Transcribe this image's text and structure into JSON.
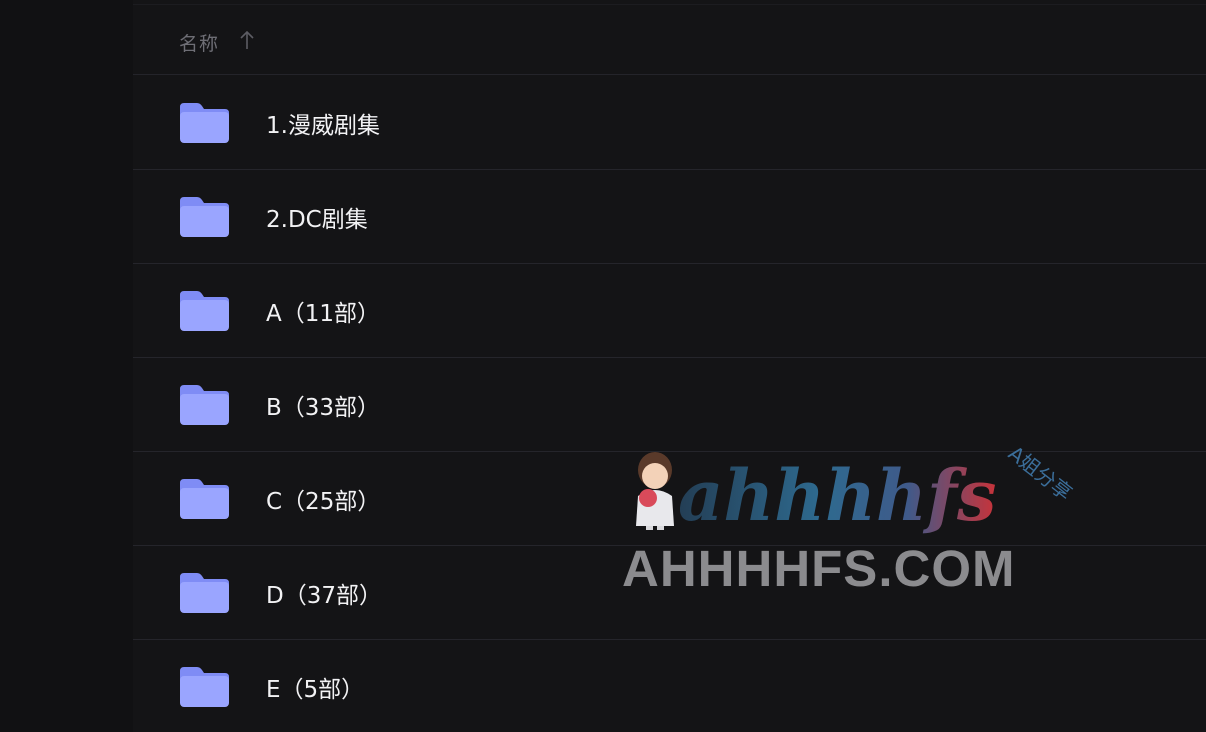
{
  "file_list": {
    "header": {
      "name_column_label": "名称",
      "sort_direction": "ascending"
    },
    "folders": [
      {
        "name": "1.漫威剧集",
        "icon": "folder-icon"
      },
      {
        "name": "2.DC剧集",
        "icon": "folder-icon"
      },
      {
        "name": "A（11部）",
        "icon": "folder-icon"
      },
      {
        "name": "B（33部）",
        "icon": "folder-icon"
      },
      {
        "name": "C（25部）",
        "icon": "folder-icon"
      },
      {
        "name": "D（37部）",
        "icon": "folder-icon"
      },
      {
        "name": "E（5部）",
        "icon": "folder-icon"
      }
    ]
  },
  "watermark": {
    "logo_text": "ahhhhfs",
    "side_text": "A姐分享",
    "domain_text": "AHHHHFS.COM"
  },
  "colors": {
    "background": "#131315",
    "divider": "#25252b",
    "folder_body": "#9aa5ff",
    "folder_tab": "#7f8cf5",
    "text_primary": "#f2f2f4",
    "text_secondary": "#6e6e75"
  }
}
